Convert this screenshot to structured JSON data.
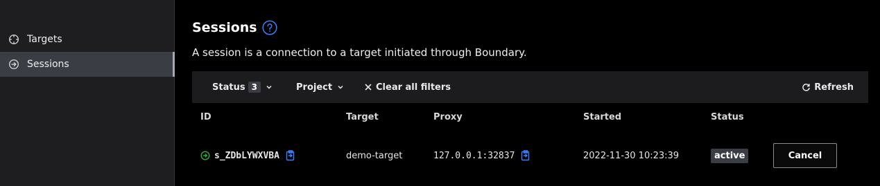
{
  "sidebar": {
    "items": [
      {
        "label": "Targets",
        "icon": "crosshair-icon"
      },
      {
        "label": "Sessions",
        "icon": "sign-in-icon"
      }
    ]
  },
  "main": {
    "title": "Sessions",
    "description": "A session is a connection to a target initiated through Boundary.",
    "filters": {
      "status_label": "Status",
      "status_count": "3",
      "project_label": "Project",
      "clear_label": "Clear all filters",
      "refresh_label": "Refresh"
    },
    "table": {
      "columns": [
        "ID",
        "Target",
        "Proxy",
        "Started",
        "Status"
      ],
      "rows": [
        {
          "id": "s_ZDbLYWXVBA",
          "target": "demo-target",
          "proxy": "127.0.0.1:32837",
          "started": "2022-11-30 10:23:39",
          "status": "active",
          "action": "Cancel"
        }
      ]
    }
  },
  "colors": {
    "accent": "#3d7fff",
    "active_session": "#2eb039",
    "sidebar_bg": "#1e1e21",
    "selected_bg": "#3b3d45"
  }
}
